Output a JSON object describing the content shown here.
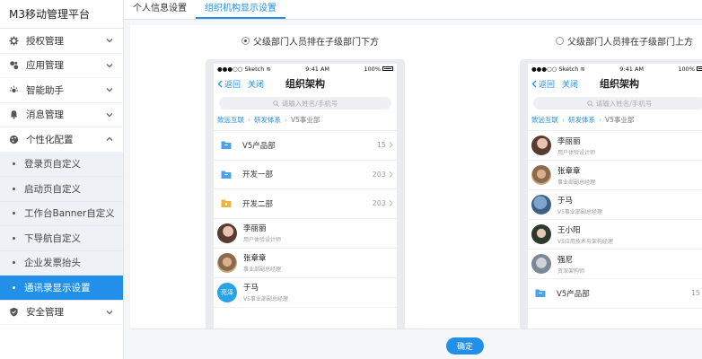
{
  "app_title": "M3移动管理平台",
  "sidebar": {
    "items": [
      {
        "label": "授权管理",
        "icon": "gear-icon"
      },
      {
        "label": "应用管理",
        "icon": "apps-icon"
      },
      {
        "label": "智能助手",
        "icon": "sun-icon"
      },
      {
        "label": "消息管理",
        "icon": "bell-icon"
      },
      {
        "label": "个性化配置",
        "icon": "palette-icon"
      }
    ],
    "sub_items": [
      {
        "label": "登录页自定义"
      },
      {
        "label": "启动页自定义"
      },
      {
        "label": "工作台Banner自定义"
      },
      {
        "label": "下导航自定义"
      },
      {
        "label": "企业发票抬头"
      },
      {
        "label": "通讯录显示设置"
      }
    ],
    "last_item": {
      "label": "安全管理",
      "icon": "shield-icon"
    }
  },
  "tabs": [
    {
      "label": "个人信息设置"
    },
    {
      "label": "组织机构显示设置"
    }
  ],
  "options": [
    {
      "label": "父级部门人员排在子级部门下方",
      "selected": true
    },
    {
      "label": "父级部门人员排在子级部门上方",
      "selected": false
    }
  ],
  "phone": {
    "carrier": "Sketch",
    "time": "9:41 AM",
    "battery": "100%",
    "back": "返回",
    "close": "关闭",
    "title": "组织架构",
    "search_placeholder": "请输入姓名/手机号",
    "crumbs": [
      "致远互联",
      "研发体系",
      "V5事业部"
    ]
  },
  "left_list": {
    "depts": [
      {
        "name": "V5产品部",
        "count": "15",
        "color": "#4aa3e8"
      },
      {
        "name": "开发一部",
        "count": "203",
        "color": "#4aa3e8"
      },
      {
        "name": "开发二部",
        "count": "203",
        "color": "#f2b33d"
      }
    ],
    "people": [
      {
        "name": "李丽丽",
        "title": "用户体验设计师",
        "avatar_text": ""
      },
      {
        "name": "张章章",
        "title": "事业部副总经理",
        "avatar_text": ""
      },
      {
        "name": "于马",
        "title": "V5事业部副总经理",
        "avatar_text": "亮泽"
      }
    ]
  },
  "right_list": {
    "people": [
      {
        "name": "李丽丽",
        "title": "用户体验设计师"
      },
      {
        "name": "张章章",
        "title": "事业部副总经理"
      },
      {
        "name": "于马",
        "title": "V5事业部副总经理"
      },
      {
        "name": "王小阳",
        "title": "V5应用技术与架构经理"
      },
      {
        "name": "强尼",
        "title": "资深架构师"
      }
    ],
    "dept": {
      "name": "V5产品部",
      "count": "15"
    }
  },
  "confirm_label": "确定",
  "colors": {
    "accent": "#2290e9"
  }
}
